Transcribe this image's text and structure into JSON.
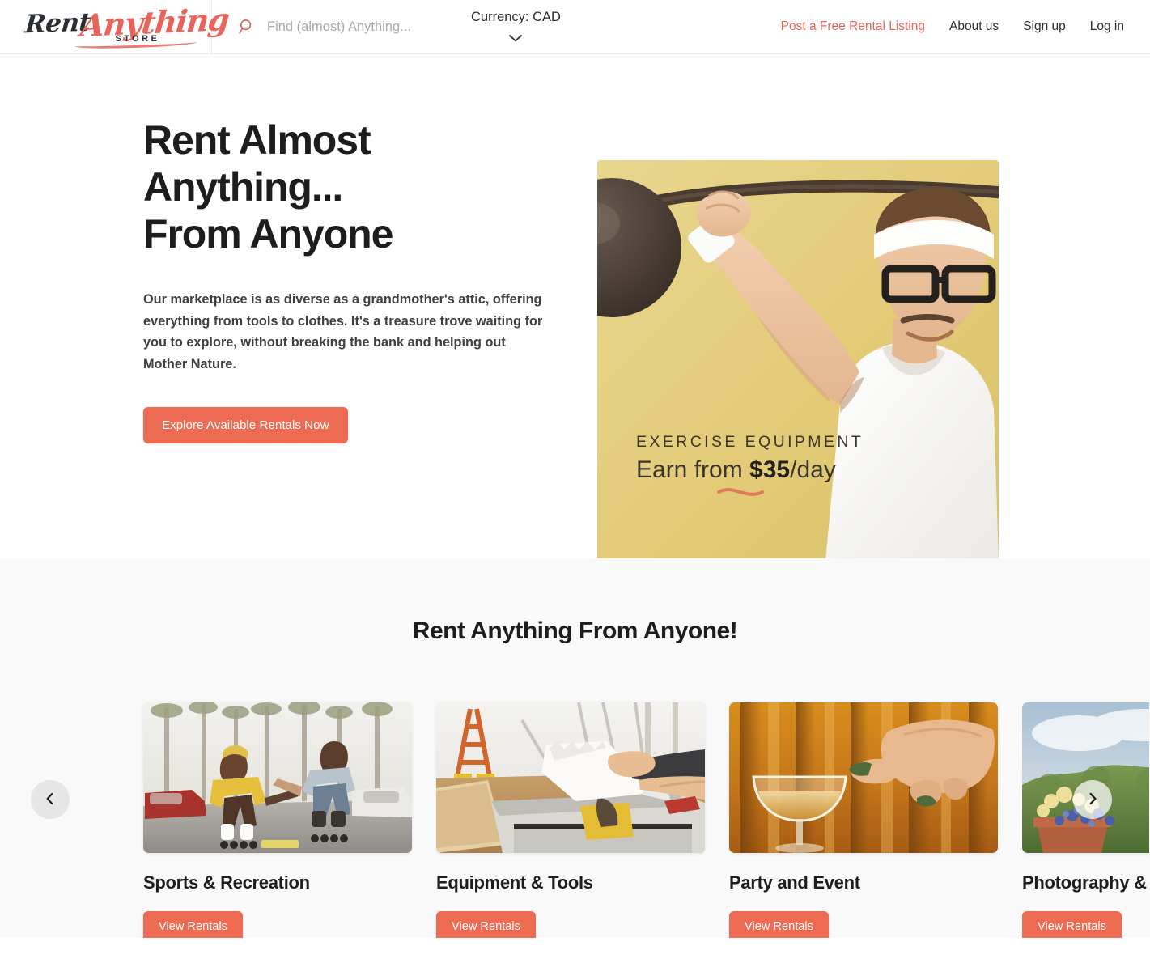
{
  "brand": {
    "word_one": "Rent",
    "word_two": "Anything",
    "word_three": "STORE",
    "accent_color": "#e8635a"
  },
  "header": {
    "search": {
      "icon": "search-icon",
      "placeholder": "Find (almost) Anything...",
      "value": ""
    },
    "currency": {
      "label": "Currency: CAD",
      "icon": "chevron-down-icon"
    },
    "nav": [
      {
        "label": "Post a Free Rental Listing",
        "accent": true
      },
      {
        "label": "About us",
        "accent": false
      },
      {
        "label": "Sign up",
        "accent": false
      },
      {
        "label": "Log in",
        "accent": false
      }
    ]
  },
  "hero": {
    "title_lines": [
      "Rent Almost",
      "Anything...",
      "From Anyone"
    ],
    "paragraph": "Our marketplace is as diverse as a grandmother's attic, offering everything from tools to clothes. It's a treasure trove waiting for you to explore, without breaking the bank and helping out Mother Nature.",
    "cta_label": "Explore Available Rentals Now",
    "image": {
      "alt": "man-lifting-barbell-photo",
      "overlay_eyebrow": "EXERCISE EQUIPMENT",
      "overlay_line_pre": "Earn from ",
      "overlay_amount": "$35",
      "overlay_line_post": "/day",
      "background_color": "#e5cf7d"
    }
  },
  "categories": {
    "heading": "Rent Anything From Anyone!",
    "prev_label": "‹",
    "next_label": "›",
    "cards": [
      {
        "title": "Sports & Recreation",
        "button_label": "View Rentals",
        "image_alt": "roller-skaters-street-photo"
      },
      {
        "title": "Equipment & Tools",
        "button_label": "View Rentals",
        "image_alt": "table-saw-workshop-photo"
      },
      {
        "title": "Party and Event",
        "button_label": "View Rentals",
        "image_alt": "cocktail-coupe-glass-photo"
      },
      {
        "title": "Photography &",
        "button_label": "View Rentals",
        "image_alt": "garden-planter-sky-photo"
      }
    ]
  }
}
